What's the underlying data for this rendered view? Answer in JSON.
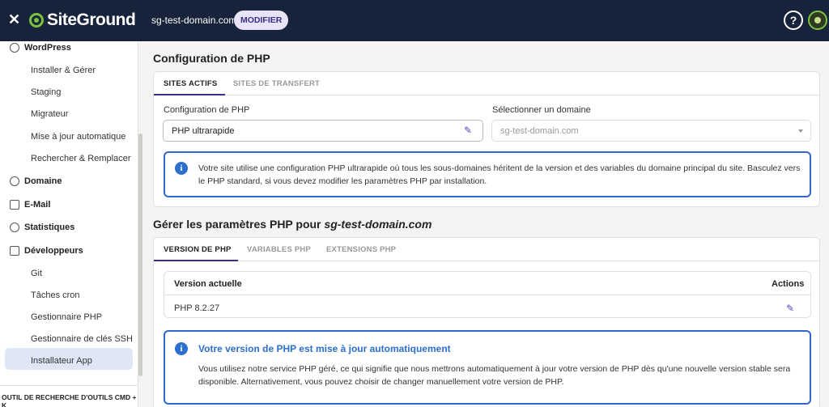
{
  "header": {
    "logo_text": "SiteGround",
    "domain": "sg-test-domain.com",
    "modify_label": "MODIFIER",
    "help_label": "?"
  },
  "sidebar": {
    "sections": [
      {
        "label": "WordPress",
        "icon": "wordpress-icon"
      },
      {
        "label": "Domaine",
        "icon": "globe-icon"
      },
      {
        "label": "E-Mail",
        "icon": "mail-icon"
      },
      {
        "label": "Statistiques",
        "icon": "chart-pie-icon"
      },
      {
        "label": "Développeurs",
        "icon": "code-icon"
      }
    ],
    "wordpress_items": [
      "Installer & Gérer",
      "Staging",
      "Migrateur",
      "Mise à jour automatique",
      "Rechercher & Remplacer"
    ],
    "dev_items": [
      "Git",
      "Tâches cron",
      "Gestionnaire PHP",
      "Gestionnaire de clés SSH",
      "Installateur App"
    ],
    "active_item": "Gestionnaire PHP",
    "bottom_search": "OUTIL DE RECHERCHE D'OUTILS CMD + K"
  },
  "main": {
    "title": "Configuration de PHP",
    "config_card": {
      "tabs": [
        "SITES ACTIFS",
        "SITES DE TRANSFERT"
      ],
      "active_tab": "SITES ACTIFS",
      "config_label": "Configuration de PHP",
      "config_value": "PHP ultrarapide",
      "domain_label": "Sélectionner un domaine",
      "domain_placeholder": "sg-test-domain.com",
      "notice": "Votre site utilise une configuration PHP ultrarapide où tous les sous-domaines héritent de la version et des variables du domaine principal du site. Basculez vers le PHP standard, si vous devez modifier les paramètres PHP par installation."
    },
    "manage_title_prefix": "Gérer les paramètres PHP pour ",
    "manage_title_domain": "sg-test-domain.com",
    "manage_tabs": [
      "VERSION DE PHP",
      "VARIABLES PHP",
      "EXTENSIONS PHP"
    ],
    "manage_active_tab": "VERSION DE PHP",
    "table": {
      "col_version": "Version actuelle",
      "col_actions": "Actions",
      "version_value": "PHP 8.2.27"
    },
    "auto_notice": {
      "title": "Votre version de PHP est mise à jour automatiquement",
      "text": "Vous utilisez notre service PHP géré, ce qui signifie que nous mettrons automatiquement à jour votre version de PHP dès qu'une nouvelle version stable sera disponible. Alternativement, vous pouvez choisir de changer manuellement votre version de PHP."
    }
  },
  "colors": {
    "topbar": "#17233a",
    "accent": "#3b2e8a",
    "info_blue": "#2d6fcf",
    "brand_green": "#7cc040"
  }
}
